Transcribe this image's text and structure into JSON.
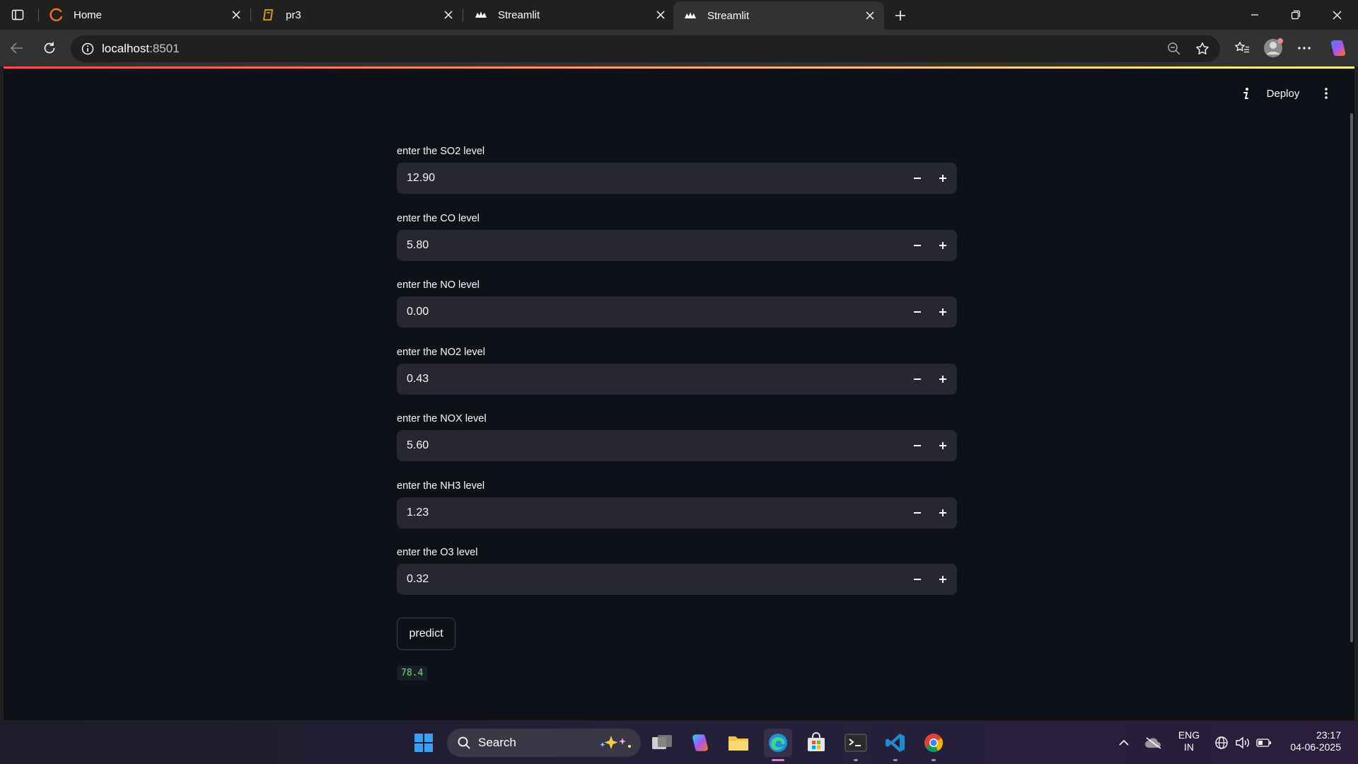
{
  "browser": {
    "tabs": [
      {
        "title": "Home",
        "icon": "loader-arc-icon"
      },
      {
        "title": "pr3",
        "icon": "book-icon"
      },
      {
        "title": "Streamlit",
        "icon": "streamlit-crown-icon"
      },
      {
        "title": "Streamlit",
        "icon": "streamlit-crown-icon",
        "active": true
      }
    ],
    "url_host": "localhost",
    "url_port": ":8501"
  },
  "app": {
    "deploy_label": "Deploy",
    "fields": [
      {
        "label": "enter the SO2 level",
        "value": "12.90"
      },
      {
        "label": "enter the CO level",
        "value": "5.80"
      },
      {
        "label": "enter the NO level",
        "value": "0.00"
      },
      {
        "label": "enter the NO2 level",
        "value": "0.43"
      },
      {
        "label": "enter the NOX level",
        "value": "5.60"
      },
      {
        "label": "enter the NH3 level",
        "value": "1.23"
      },
      {
        "label": "enter the O3 level",
        "value": "0.32"
      }
    ],
    "predict_label": "predict",
    "result": "78.4"
  },
  "taskbar": {
    "search_label": "Search",
    "language_line1": "ENG",
    "language_line2": "IN",
    "time": "23:17",
    "date": "04-06-2025"
  },
  "colors": {
    "accent_gradient_start": "#ff4b4b",
    "accent_gradient_end": "#fffd80",
    "result_text": "#5ce488",
    "page_background": "#0e1117",
    "input_background": "#262730"
  }
}
